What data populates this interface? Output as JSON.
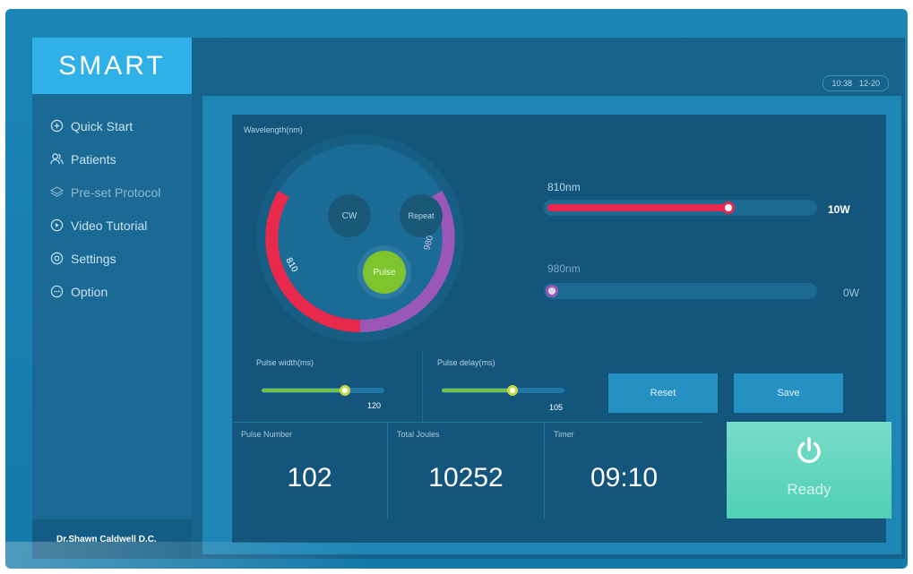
{
  "app": {
    "logo": "SMART",
    "time": "10:38",
    "date": "12-20"
  },
  "sidebar": {
    "items": [
      {
        "label": "Quick Start",
        "icon": "quick-start-icon"
      },
      {
        "label": "Patients",
        "icon": "patients-icon"
      },
      {
        "label": "Pre-set Protocol",
        "icon": "layers-icon"
      },
      {
        "label": "Video Tutorial",
        "icon": "play-icon"
      },
      {
        "label": "Settings",
        "icon": "gear-icon"
      },
      {
        "label": "Option",
        "icon": "more-icon"
      }
    ],
    "doctor": "Dr.Shawn Caldwell D.C."
  },
  "wavelength": {
    "title": "Wavelength(nm)",
    "modes": {
      "cw": "CW",
      "repeat": "Repeat",
      "pulse": "Pulse"
    },
    "ring_labels": {
      "left": "810",
      "right": "980"
    },
    "active_mode": "Pulse"
  },
  "lasers": [
    {
      "label": "810nm",
      "value": "10W",
      "level": 0.68,
      "color": "#e8294b"
    },
    {
      "label": "980nm",
      "value": "0W",
      "level": 0.0,
      "color": "#9a57b8"
    }
  ],
  "pulse": {
    "width_label": "Pulse width(ms)",
    "width_value": "120",
    "width_level": 0.68,
    "delay_label": "Pulse delay(ms)",
    "delay_value": "105",
    "delay_level": 0.58
  },
  "buttons": {
    "reset": "Reset",
    "save": "Save"
  },
  "stats": {
    "pulse_number_label": "Pulse Number",
    "pulse_number": "102",
    "total_joules_label": "Total Joules",
    "total_joules": "10252",
    "timer_label": "Timer",
    "timer": "09:10"
  },
  "status": {
    "ready": "Ready"
  },
  "colors": {
    "accent": "#2fb0e6",
    "red": "#e8294b",
    "purple": "#9a57b8",
    "green": "#7dc42d",
    "ready": "#5ed4b9"
  }
}
